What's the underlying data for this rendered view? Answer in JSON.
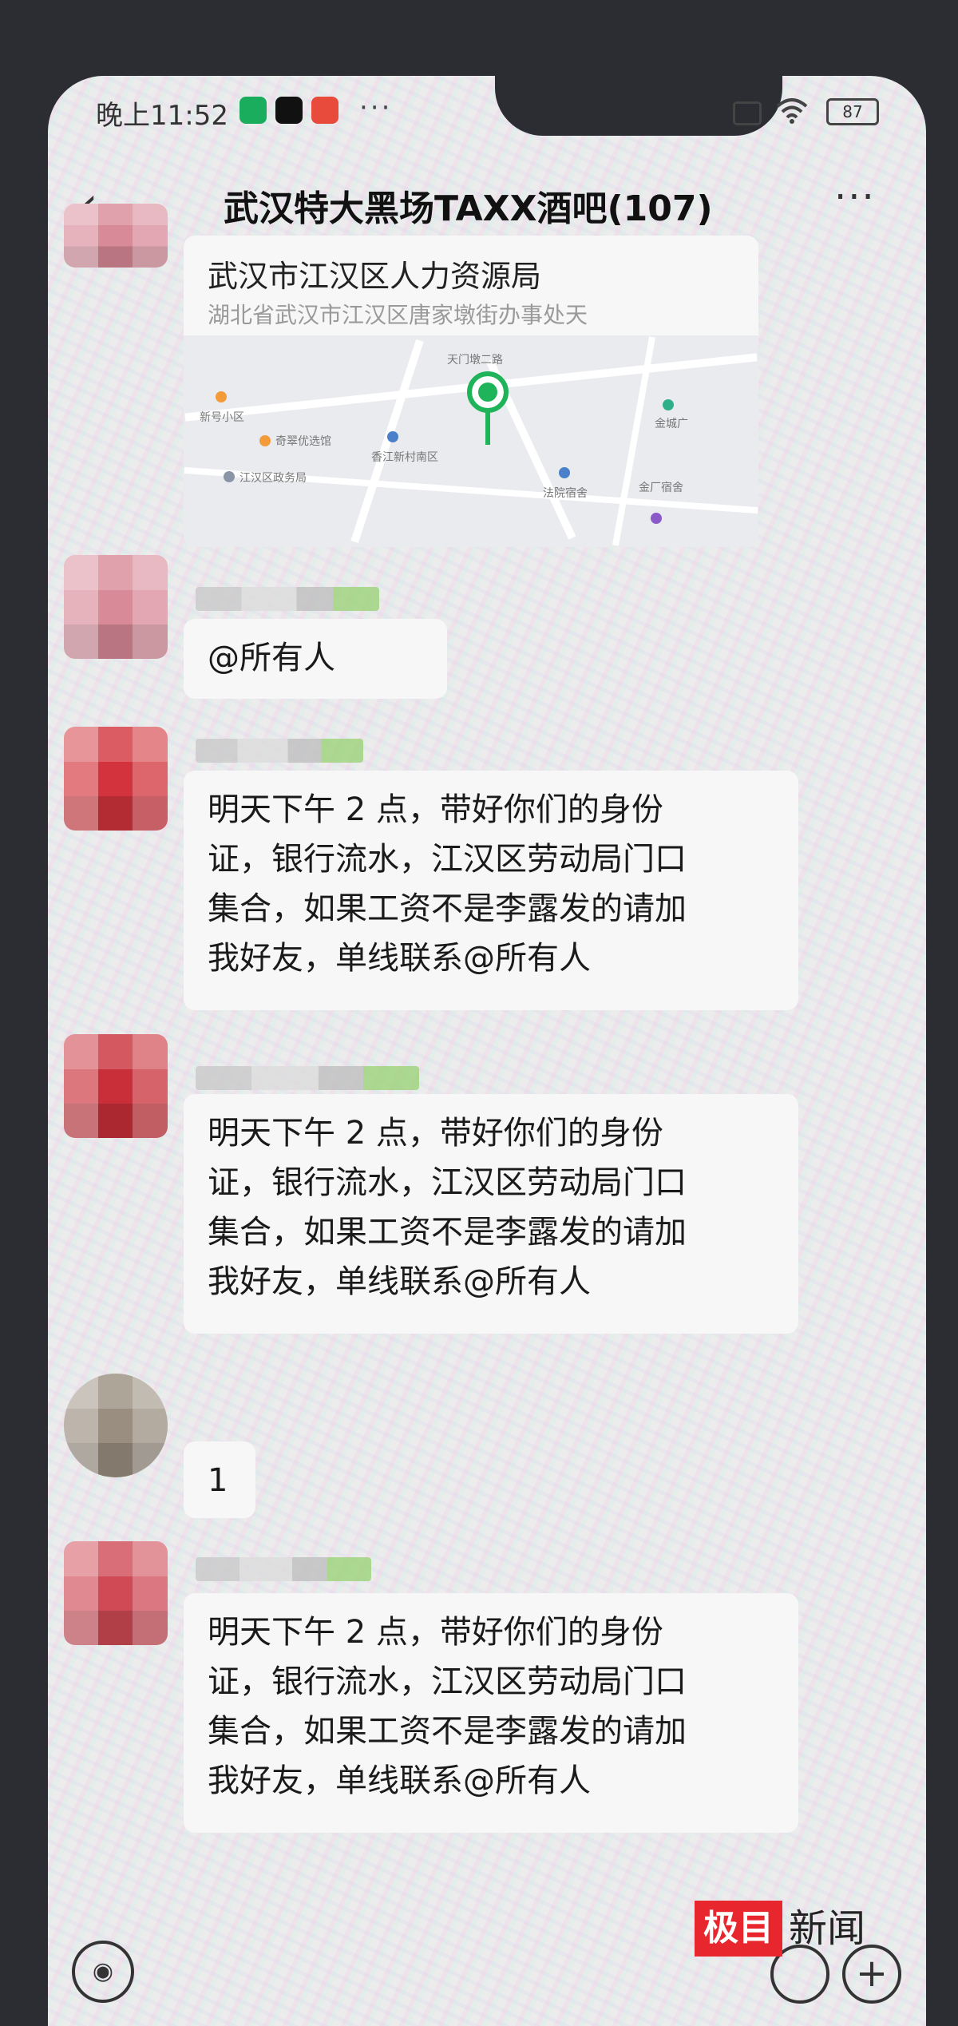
{
  "status_bar": {
    "time": "晚上11:52",
    "dots": "···",
    "battery": "87"
  },
  "header": {
    "back_icon": "‹",
    "title": "武汉特大黑场TAXX酒吧(107)",
    "more_icon": "···"
  },
  "location_card": {
    "title": "武汉市江汉区人力资源局",
    "address": "湖北省武汉市江汉区唐家墩街办事处天",
    "map_labels": [
      "新号小区",
      "奇翠优选馆",
      "江汉区政务局",
      "香江新村南区",
      "法院宿舍",
      "金厂宿舍",
      "金城广",
      "天门墩二路"
    ]
  },
  "messages": [
    {
      "lines": [
        "@所有人"
      ]
    },
    {
      "lines": [
        "明天下午 2 点，带好你们的身份",
        "证，银行流水，江汉区劳动局门口",
        "集合，如果工资不是李露发的请加",
        "我好友，单线联系@所有人"
      ]
    },
    {
      "lines": [
        "明天下午 2 点，带好你们的身份",
        "证，银行流水，江汉区劳动局门口",
        "集合，如果工资不是李露发的请加",
        "我好友，单线联系@所有人"
      ]
    },
    {
      "lines": [
        "1"
      ]
    },
    {
      "lines": [
        "明天下午 2 点，带好你们的身份",
        "证，银行流水，江汉区劳动局门口",
        "集合，如果工资不是李露发的请加",
        "我好友，单线联系@所有人"
      ]
    }
  ],
  "bottom_bar": {
    "voice_icon": "◉",
    "plus_icon": "+"
  },
  "watermark": {
    "box": "极目",
    "text": "新闻"
  },
  "colors": {
    "accent_green": "#1fb35a",
    "bubble_bg": "#f7f7f7",
    "watermark_red": "#e8262d"
  }
}
